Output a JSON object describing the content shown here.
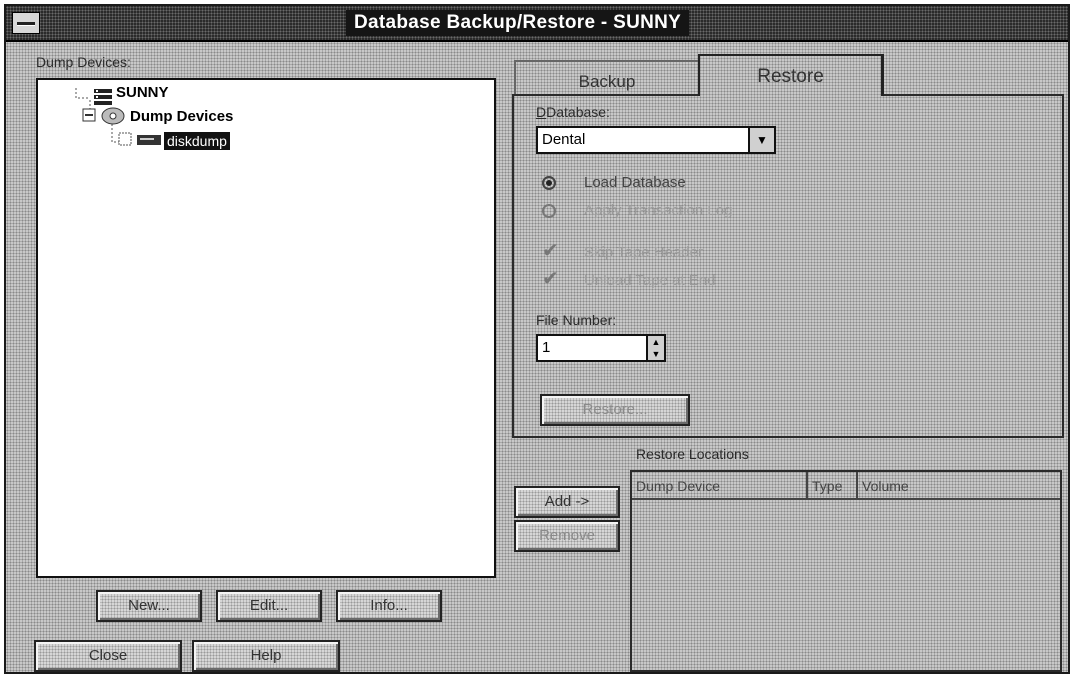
{
  "window": {
    "title": "Database Backup/Restore - SUNNY"
  },
  "left": {
    "label": "Dump Devices:",
    "tree": {
      "root": "SUNNY",
      "folder": "Dump Devices",
      "device": "diskdump"
    },
    "buttons": {
      "new": "New...",
      "edit": "Edit...",
      "info": "Info..."
    }
  },
  "footer": {
    "close": "Close",
    "help": "Help"
  },
  "tabs": [
    {
      "label": "Backup",
      "active": false
    },
    {
      "label": "Restore",
      "active": true
    }
  ],
  "restore": {
    "database_label": "Database:",
    "database_value": "Dental",
    "load_database": "Load Database",
    "apply_log": "Apply Transaction Log",
    "skip_header": "Skip Tape Header",
    "unload_tape": "Unload Tape at End",
    "file_number_label": "File Number:",
    "file_number_value": "1",
    "restore_button": "Restore..."
  },
  "locations": {
    "label": "Restore Locations",
    "columns": [
      "Dump Device",
      "Type",
      "Volume"
    ],
    "add": "Add ->",
    "remove": "Remove"
  }
}
